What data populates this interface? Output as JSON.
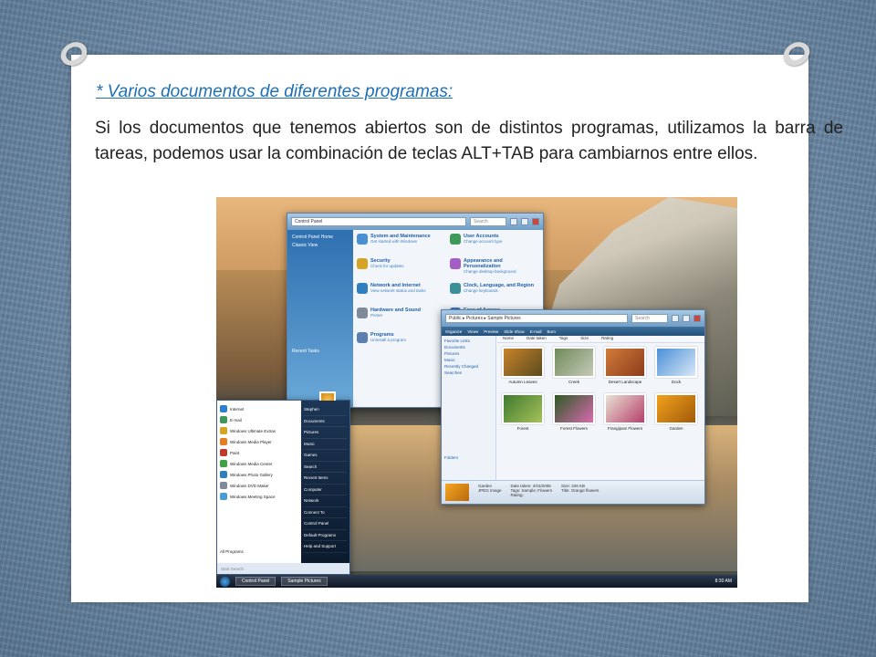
{
  "slide": {
    "heading": "* Varios documentos de diferentes programas:",
    "paragraph": "Si los documentos que tenemos abiertos son de distintos programas, utilizamos la barra de tareas,  podemos usar la combinación de teclas ALT+TAB  para cambiarnos entre ellos."
  },
  "screenshot": {
    "control_panel": {
      "address": "Control Panel",
      "search_placeholder": "Search",
      "side": [
        "Control Panel Home",
        "Classic View"
      ],
      "recent_tasks": "Recent Tasks",
      "items": [
        {
          "title": "System and Maintenance",
          "sub": "Get started with Windows",
          "color": "#4a8fd1"
        },
        {
          "title": "User Accounts",
          "sub": "Change account type",
          "color": "#3f9a5a"
        },
        {
          "title": "Security",
          "sub": "Check for updates",
          "color": "#d6a422"
        },
        {
          "title": "Appearance and Personalization",
          "sub": "Change desktop background",
          "color": "#a35fc7"
        },
        {
          "title": "Network and Internet",
          "sub": "View network status and tasks",
          "color": "#2f7fbf"
        },
        {
          "title": "Clock, Language, and Region",
          "sub": "Change keyboards",
          "color": "#3b8f99"
        },
        {
          "title": "Hardware and Sound",
          "sub": "Printer",
          "color": "#7f8a99"
        },
        {
          "title": "Ease of Access",
          "sub": "Optimize visual display",
          "color": "#3c7ac4"
        },
        {
          "title": "Programs",
          "sub": "Uninstall a program",
          "color": "#5a7fb0"
        },
        {
          "title": "Additional Options",
          "sub": "",
          "color": "#7b9ec4"
        }
      ]
    },
    "pictures": {
      "address": "Public ▸ Pictures ▸ Sample Pictures",
      "search_placeholder": "Search",
      "toolbar": [
        "Organize",
        "Views",
        "Preview",
        "Slide Show",
        "E-mail",
        "Burn"
      ],
      "nav": [
        "Favorite Links",
        "Documents",
        "Pictures",
        "Music",
        "Recently Changed",
        "Searches"
      ],
      "folders_label": "Folders",
      "columns": [
        "Name",
        "Date taken",
        "Tags",
        "Size",
        "Rating"
      ],
      "thumbs": [
        {
          "label": "Autumn Leaves",
          "c1": "#c8842c",
          "c2": "#5b4a1c"
        },
        {
          "label": "Creek",
          "c1": "#6f8b5a",
          "c2": "#c5c9b8"
        },
        {
          "label": "Desert Landscape",
          "c1": "#d27b3a",
          "c2": "#8b3d1c"
        },
        {
          "label": "Dock",
          "c1": "#4a8fd6",
          "c2": "#d9e8f7"
        },
        {
          "label": "Forest",
          "c1": "#3f7a2f",
          "c2": "#a6c25a"
        },
        {
          "label": "Forest Flowers",
          "c1": "#2c5a23",
          "c2": "#d96ab0"
        },
        {
          "label": "Frangipani Flowers",
          "c1": "#e9e3d5",
          "c2": "#b63f6a"
        },
        {
          "label": "Garden",
          "c1": "#f2a11c",
          "c2": "#a15a0a"
        }
      ],
      "details": {
        "name": "Garden",
        "type": "JPEG Image",
        "date": "Date taken: 4/15/2005",
        "tags": "Tags: Sample; Flowers",
        "size": "Size: 226 KB",
        "title": "Title: Orange flowers",
        "rating": "Rating:"
      }
    },
    "start_menu": {
      "left_items": [
        {
          "label": "Internet",
          "color": "#2f7fd1"
        },
        {
          "label": "E-mail",
          "color": "#3f9a5a"
        },
        {
          "label": "Windows Ultimate Extras",
          "color": "#d6a422"
        },
        {
          "label": "Windows Media Player",
          "color": "#e67e22"
        },
        {
          "label": "Paint",
          "color": "#c0392b"
        },
        {
          "label": "Windows Media Center",
          "color": "#3fa046"
        },
        {
          "label": "Windows Photo Gallery",
          "color": "#2f7fbf"
        },
        {
          "label": "Windows DVD Maker",
          "color": "#7f8a99"
        },
        {
          "label": "Windows Meeting Space",
          "color": "#4b9bd6"
        }
      ],
      "all_programs": "All Programs",
      "search_placeholder": "Start Search",
      "right_items": [
        "Stephen",
        "Documents",
        "Pictures",
        "Music",
        "Games",
        "Search",
        "Recent Items",
        "Computer",
        "Network",
        "Connect To",
        "Control Panel",
        "Default Programs",
        "Help and Support"
      ]
    },
    "taskbar": {
      "buttons": [
        "Control Panel",
        "Sample Pictures"
      ],
      "clock": "8:30 AM"
    }
  }
}
